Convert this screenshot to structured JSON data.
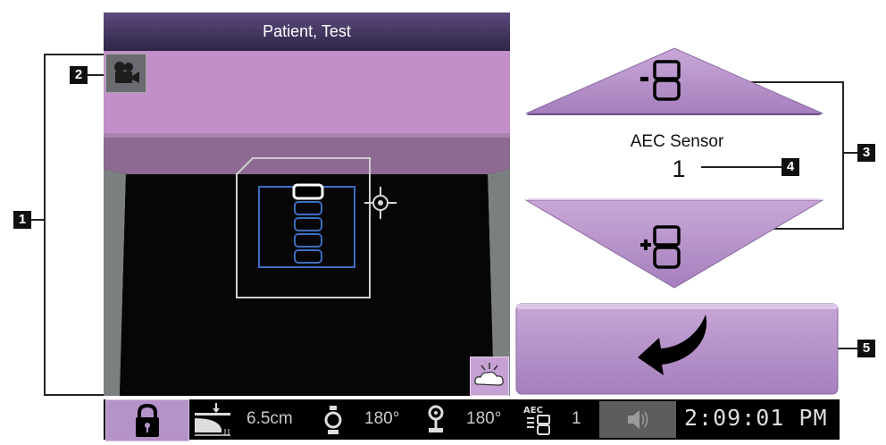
{
  "header": {
    "patient_name": "Patient, Test"
  },
  "callouts": {
    "one": "1",
    "two": "2",
    "three": "3",
    "four": "4",
    "five": "5"
  },
  "aec": {
    "label": "AEC Sensor",
    "value": "1",
    "decrease_icon": "aec-minus-icon",
    "increase_icon": "aec-plus-icon"
  },
  "accept_button": {
    "icon": "return-arrow-icon"
  },
  "status_bar": {
    "lock_icon": "lock-icon",
    "compression_icon": "compression-thickness-icon",
    "thickness": "6.5cm",
    "tube_angle_icon": "tube-angle-icon",
    "tube_angle": "180°",
    "arm_angle_icon": "detector-angle-icon",
    "arm_angle": "180°",
    "aec_icon": "aec-status-icon",
    "aec_value": "1",
    "speaker_icon": "speaker-icon",
    "time": "2:09:01 PM"
  },
  "colors": {
    "button_purple": "#b68fca",
    "title_purple": "#4a3a66",
    "paddle_pink": "#c090c7",
    "status_bg": "#000000",
    "sensor_blue": "#3d6ebf"
  }
}
